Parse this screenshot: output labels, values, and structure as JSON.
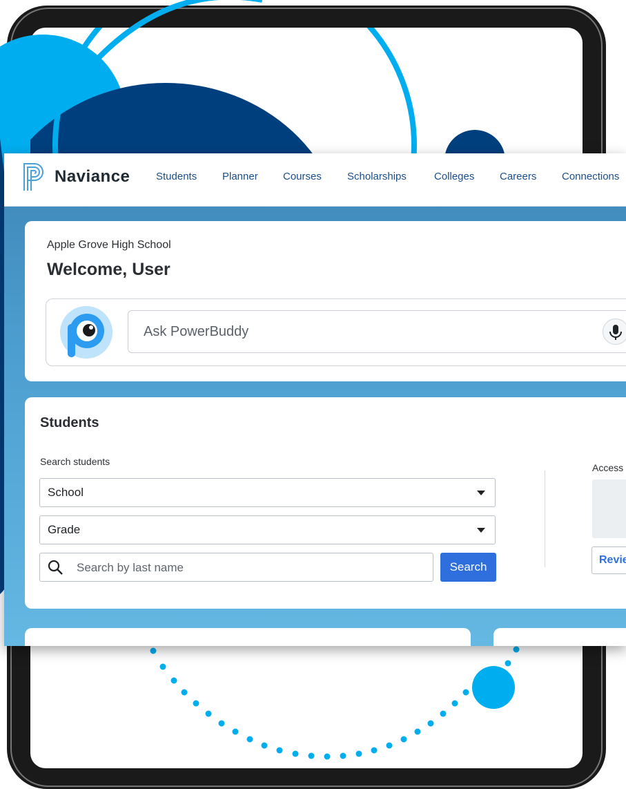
{
  "app": {
    "name": "Naviance"
  },
  "nav": {
    "items": [
      {
        "label": "Students"
      },
      {
        "label": "Planner"
      },
      {
        "label": "Courses"
      },
      {
        "label": "Scholarships"
      },
      {
        "label": "Colleges"
      },
      {
        "label": "Careers"
      },
      {
        "label": "Connections"
      }
    ]
  },
  "welcome": {
    "school": "Apple Grove High School",
    "greeting": "Welcome, User",
    "powerbuddy_placeholder": "Ask PowerBuddy"
  },
  "students": {
    "title": "Students",
    "search_label": "Search students",
    "school_select": "School",
    "grade_select": "Grade",
    "search_placeholder": "Search by last name",
    "search_button": "Search",
    "access_label": "Access",
    "review_button": "Revie"
  },
  "colors": {
    "accent_blue": "#2e6fdd",
    "brand_navy": "#003f7d",
    "brand_cyan": "#00aeef",
    "nav_link": "#1b4f8a"
  },
  "icons": [
    "naviance-logo-icon",
    "powerbuddy-avatar-icon",
    "microphone-icon",
    "search-icon",
    "chevron-down-icon"
  ]
}
